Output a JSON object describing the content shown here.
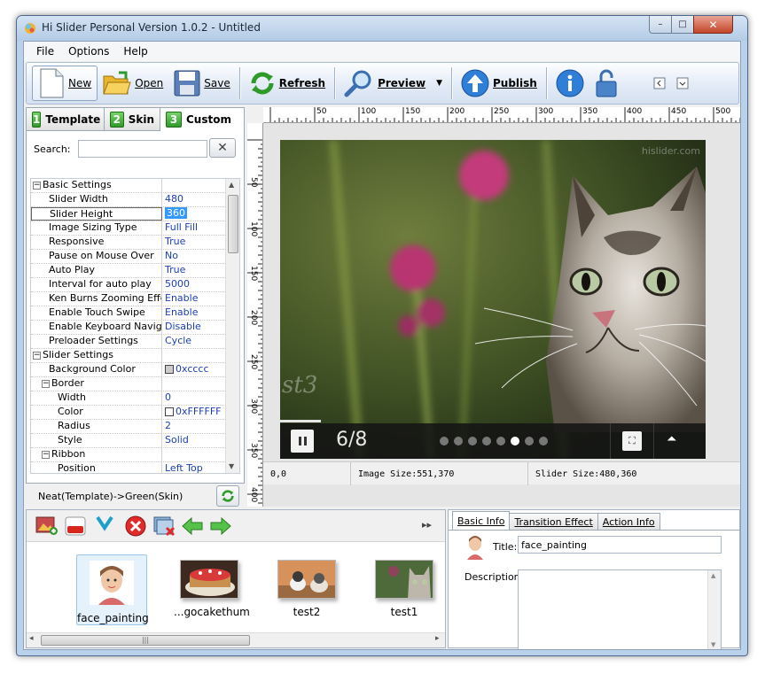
{
  "window": {
    "title": "Hi Slider Personal Version 1.0.2  - Untitled",
    "minimize_glyph": "–",
    "maximize_glyph": "□",
    "close_glyph": "✕"
  },
  "menu": {
    "items": [
      "File",
      "Options",
      "Help"
    ]
  },
  "toolbar": {
    "new_label": "New",
    "open_label": "Open",
    "save_label": "Save",
    "refresh_label": "Refresh",
    "preview_label": "Preview",
    "publish_label": "Publish",
    "dropdown_glyph": "▼"
  },
  "tabs": [
    {
      "num": "1",
      "label": "Template"
    },
    {
      "num": "2",
      "label": "Skin"
    },
    {
      "num": "3",
      "label": "Custom"
    }
  ],
  "search": {
    "label": "Search:",
    "value": "",
    "clear_glyph": "✕"
  },
  "properties": [
    {
      "kind": "cat",
      "toggle": "−",
      "name": "Basic Settings",
      "value": ""
    },
    {
      "kind": "item",
      "name": "Slider Width",
      "value": "480"
    },
    {
      "kind": "item",
      "name": "Slider Height",
      "value": "360",
      "selected": true
    },
    {
      "kind": "item",
      "name": "Image Sizing Type",
      "value": "Full Fill"
    },
    {
      "kind": "item",
      "name": "Responsive",
      "value": "True"
    },
    {
      "kind": "item",
      "name": "Pause on Mouse Over",
      "value": "No"
    },
    {
      "kind": "item",
      "name": "Auto Play",
      "value": "True"
    },
    {
      "kind": "item",
      "name": "Interval for auto play",
      "value": "5000"
    },
    {
      "kind": "item",
      "name": "Ken Burns Zooming Effect",
      "value": "Enable"
    },
    {
      "kind": "item",
      "name": "Enable Touch Swipe",
      "value": "Enable"
    },
    {
      "kind": "item",
      "name": "Enable Keyboard Navig...",
      "value": "Disable"
    },
    {
      "kind": "item",
      "name": "Preloader Settings",
      "value": "Cycle"
    },
    {
      "kind": "cat",
      "toggle": "−",
      "name": "Slider Settings",
      "value": ""
    },
    {
      "kind": "item",
      "name": "Background Color",
      "value": "0xcccc",
      "swatch": "#cccccc"
    },
    {
      "kind": "sub",
      "toggle": "−",
      "name": "Border",
      "value": ""
    },
    {
      "kind": "sub2",
      "name": "Width",
      "value": "0"
    },
    {
      "kind": "sub2",
      "name": "Color",
      "value": "0xFFFFFF",
      "swatch": "#ffffff"
    },
    {
      "kind": "sub2",
      "name": "Radius",
      "value": "2"
    },
    {
      "kind": "sub2",
      "name": "Style",
      "value": "Solid"
    },
    {
      "kind": "sub",
      "toggle": "−",
      "name": "Ribbon",
      "value": ""
    },
    {
      "kind": "sub2",
      "name": "Position",
      "value": "Left Top"
    }
  ],
  "template_status": "Neat(Template)->Green(Skin)",
  "ruler": {
    "h_labels": [
      "50",
      "100",
      "150",
      "200",
      "250",
      "300",
      "350",
      "400",
      "450",
      "500"
    ],
    "v_labels": [
      "50",
      "100",
      "150",
      "200",
      "250",
      "300",
      "350",
      "400"
    ]
  },
  "slider": {
    "watermark": "hislider.com",
    "counter": "6/8",
    "dots_total": 8,
    "dots_active": 6,
    "corner_text": "st3",
    "fullscreen_glyph": "⛶",
    "up_glyph": "⏶"
  },
  "preview_status": {
    "coords": "0,0",
    "image_size": "Image Size:551,370",
    "slider_size": "Slider Size:480,360"
  },
  "media_toolbar": {
    "collapse_glyph": "▸▸",
    "youtube_text": "You Tube",
    "vimeo_text": "vimeo"
  },
  "thumbnails": [
    {
      "caption": "face_painting",
      "selected": true
    },
    {
      "caption": "...gocakethum",
      "selected": false
    },
    {
      "caption": "test2",
      "selected": false
    },
    {
      "caption": "test1",
      "selected": false
    }
  ],
  "hscroll": {
    "left_glyph": "◂",
    "right_glyph": "▸",
    "grip": "|||"
  },
  "info_tabs": [
    "Basic Info",
    "Transition Effect",
    "Action Info"
  ],
  "info": {
    "title_label": "Title:",
    "title_value": "face_painting",
    "description_label": "Description:",
    "description_value": ""
  }
}
